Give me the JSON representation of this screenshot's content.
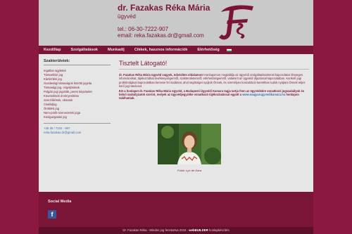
{
  "header": {
    "name": "dr. Fazakas Réka Mária",
    "subtitle": "ügyvéd",
    "tel": "tel.: 06-30-7222-907",
    "email": "email: reka.fazakas.dr@gmail.com",
    "logo_icon": "fr-monogram-logo"
  },
  "nav": {
    "items": [
      "Kezdőlap",
      "Szolgáltatások",
      "Munkadíj",
      "Cikkek, hasznos információk",
      "Elérhetőség"
    ],
    "flag_colors": [
      "#cd2a3e",
      "#ffffff",
      "#436f4d"
    ]
  },
  "sidebar": {
    "title": "Szakterületek:",
    "items": [
      "Ingatlan ügyletek",
      "Társasházi jog",
      "Kártérítési jog",
      "Gazdasági társaságok közötti jogvita",
      "Társasági jog, cégeljárások",
      "Polgári jogi jogviták, peres képviselet",
      "Követelések érvényesítése",
      "Szerződések, okiratok",
      "Családjog",
      "Öröklési jog",
      "Nem-profit szervezetek joga",
      "Közigazgatási jog"
    ],
    "phone": "+36 30 / 7222 - 907",
    "email": "reka.fazakas.dr@gmail.com"
  },
  "main": {
    "title": "Tisztelt Látogató!",
    "p1_bold": "dr. Fazakas Réka Mária ügyvéd vagyok, üdvözlöm oldalamon!",
    "p1_rest": " Honlapomon megtalálja az ügyvédi szolgáltatásaimmal kapcsolatos lényeges információkat, tájékozódhat tevékenységemről, szakterületeimről, elérhetőségeimről, valamint az ügyvédi díjazással kapcsolatban. Konkrét jogi problémájával kapcsolatban keresse fel irodámat, ahol segítséget nyújtok Önnek, és személyes konzultáció keretében tudok nyújtani Önnek teljes körű jogi tanácsot.",
    "p2": "Ezt a honlapot dr. Fazakas Réka Mária ügyvéd, a Budapesti Ügyvédi Kamara tagja tartja fenn az ügyvédekre vonatkozó jogszabályok és belső szabályzatok szerint, melyek az ügyvédjegyzéke vonatkozó tájékoztatással együtt a",
    "link": "www.magyarugyvedikamara.hu",
    "p2_end": " honlapon találhatóak.",
    "photo_caption": "Fotók: Lyn de Gara"
  },
  "footer": {
    "social_title": "Social Media",
    "fb_icon": "facebook-icon",
    "copyright_prefix": "Dr. Fazakas Réka - Minden jog fenntartva 2015 - ",
    "copyright_brand": "webBUILDER",
    "copyright_suffix": " honlapkészítés"
  }
}
